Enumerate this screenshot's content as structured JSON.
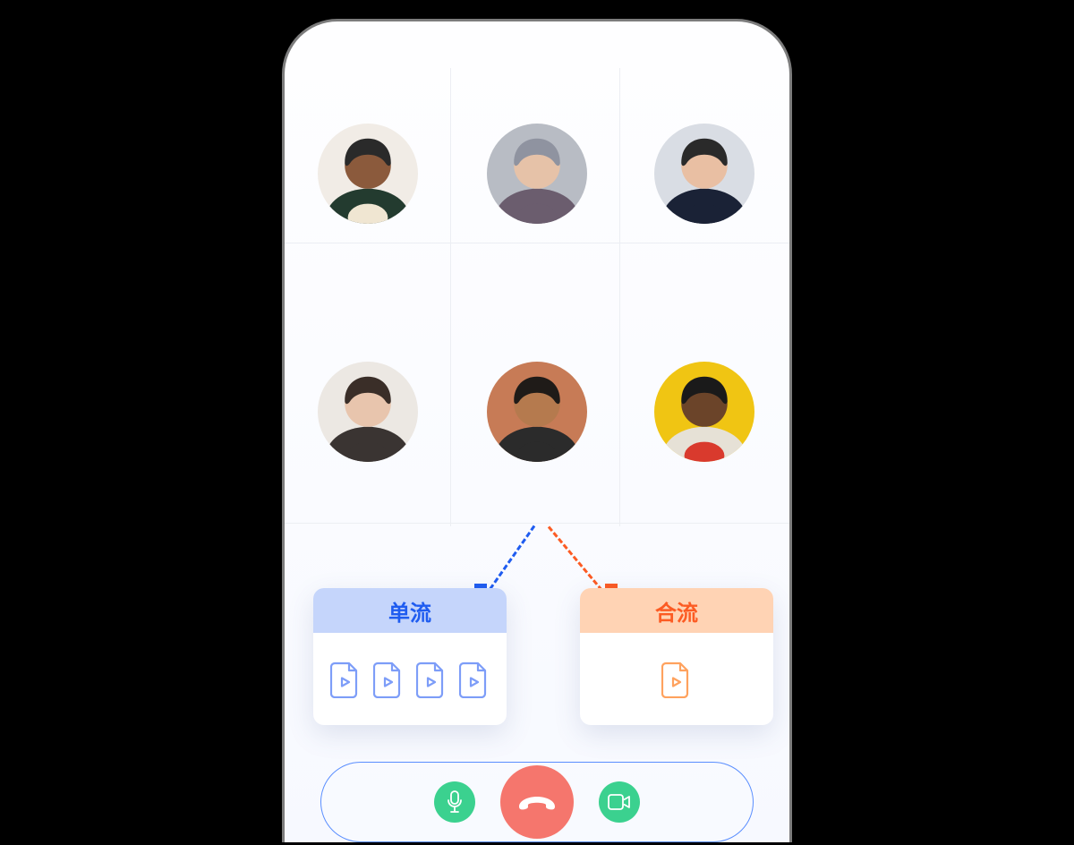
{
  "participants": [
    {
      "bg": "#f1ece6",
      "skin": "#8b5a3c",
      "top": "#233b2f",
      "accent": "#f0e6d2"
    },
    {
      "bg": "#b8bcc4",
      "skin": "#e6c2a8",
      "top": "#6b5d6e",
      "hair": "#8f93a0"
    },
    {
      "bg": "#d9dde4",
      "skin": "#e9bfa3",
      "top": "#1a2236",
      "tie": "#141a2a"
    },
    {
      "bg": "#ece8e3",
      "skin": "#e8c5ad",
      "top": "#3a3432",
      "hair": "#3a2e28"
    },
    {
      "bg": "#c77b56",
      "skin": "#b57a4e",
      "top": "#2b2b2b",
      "hair": "#1f1b18"
    },
    {
      "bg": "#f0c513",
      "skin": "#6b4429",
      "top": "#e6e1d6",
      "accent": "#d93a2d",
      "hair": "#1a1a1a"
    }
  ],
  "modes": {
    "single": {
      "label": "单流",
      "icons": 4
    },
    "merge": {
      "label": "合流",
      "icons": 1
    }
  },
  "colors": {
    "blue": "#1f5cf0",
    "orange": "#fc5b23",
    "green": "#3bd18f",
    "red": "#f5766d"
  },
  "icons": {
    "mic": "mic-icon",
    "hangup": "hangup-icon",
    "video": "video-icon",
    "video_file": "video-file-icon"
  }
}
